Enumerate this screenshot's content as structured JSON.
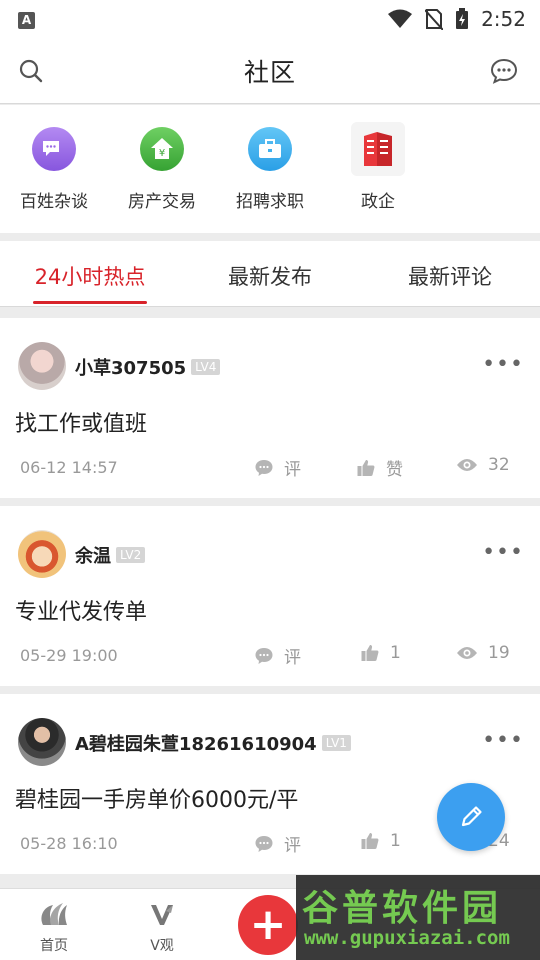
{
  "status_bar": {
    "time": "2:52",
    "notification_badge": "A"
  },
  "header": {
    "title": "社区"
  },
  "categories": [
    {
      "label": "百姓杂谈",
      "icon": "chat-bubbles-icon",
      "color": "#9b6ae6"
    },
    {
      "label": "房产交易",
      "icon": "house-yuan-icon",
      "color": "#4cb84a"
    },
    {
      "label": "招聘求职",
      "icon": "briefcase-icon",
      "color": "#3fb1ee"
    },
    {
      "label": "政企",
      "icon": "building-icon",
      "color": "#e8373b"
    }
  ],
  "tabs": [
    {
      "label": "24小时热点",
      "active": true
    },
    {
      "label": "最新发布",
      "active": false
    },
    {
      "label": "最新评论",
      "active": false
    }
  ],
  "posts": [
    {
      "username": "小草307505",
      "level": "LV4",
      "text": "找工作或值班",
      "time": "06-12 14:57",
      "comment": "评",
      "like": "赞",
      "views": "32"
    },
    {
      "username": "余温",
      "level": "LV2",
      "text": "专业代发传单",
      "time": "05-29 19:00",
      "comment": "评",
      "like": "1",
      "views": "19"
    },
    {
      "username": "A碧桂园朱萱18261610904",
      "level": "LV1",
      "text": "碧桂园一手房单价6000元/平",
      "time": "05-28 16:10",
      "comment": "评",
      "like": "1",
      "views": "24"
    }
  ],
  "more_label": "•••",
  "bottom_nav": [
    {
      "label": "首页",
      "icon": "home-logo-icon"
    },
    {
      "label": "V观",
      "icon": "v-logo-icon"
    },
    {
      "label": "+",
      "icon": "plus-icon"
    }
  ],
  "watermark": {
    "line1": "谷普软件园",
    "line2": "www.gupuxiazai.com"
  },
  "colors": {
    "accent": "#d8232a",
    "fab": "#3c9ff0",
    "plus": "#e8373b"
  }
}
